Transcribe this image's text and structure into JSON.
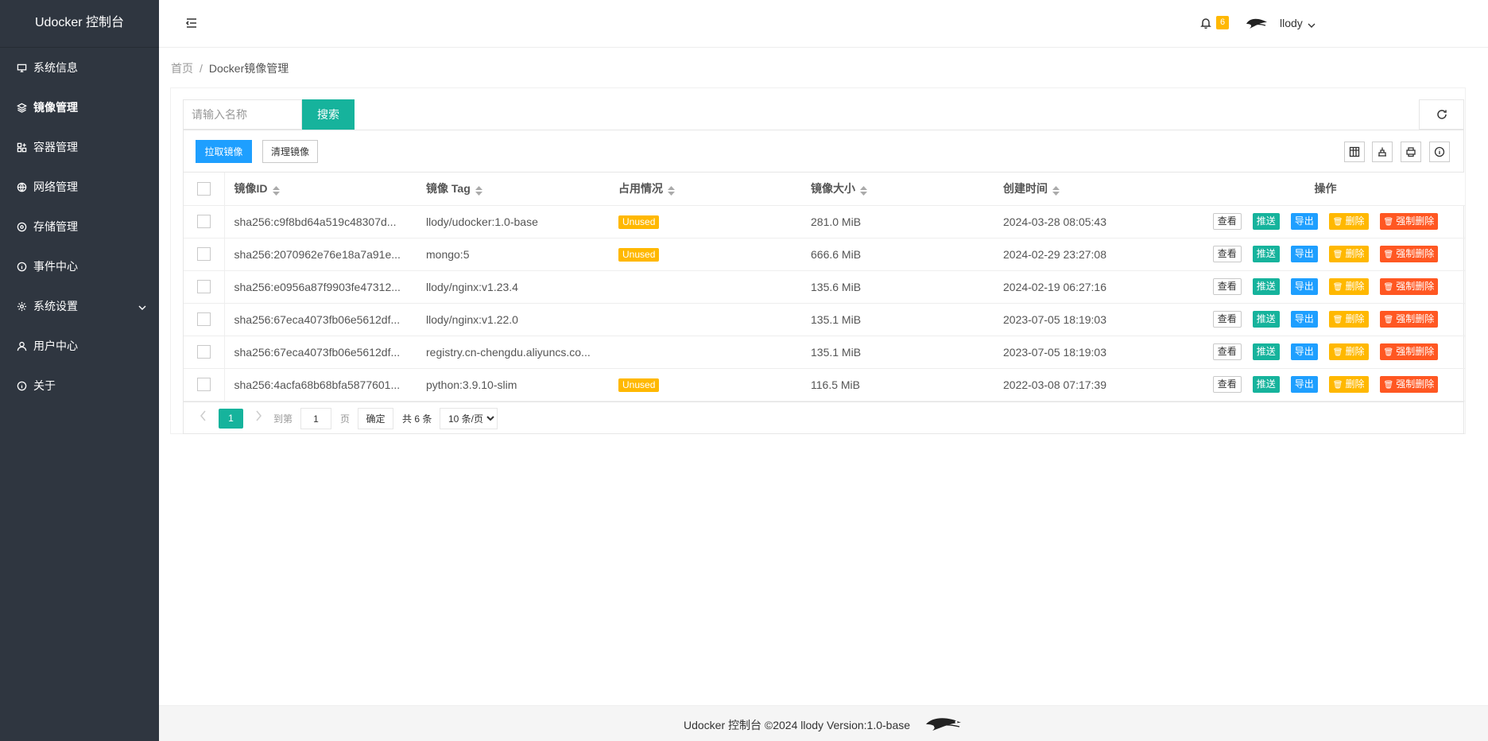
{
  "sidebar": {
    "brand": "Udocker 控制台",
    "items": [
      {
        "label": "系统信息",
        "icon": "monitor-icon"
      },
      {
        "label": "镜像管理",
        "icon": "layers-icon"
      },
      {
        "label": "容器管理",
        "icon": "container-icon"
      },
      {
        "label": "网络管理",
        "icon": "globe-icon"
      },
      {
        "label": "存储管理",
        "icon": "storage-icon"
      },
      {
        "label": "事件中心",
        "icon": "info-icon"
      },
      {
        "label": "系统设置",
        "icon": "gear-icon"
      },
      {
        "label": "用户中心",
        "icon": "user-icon"
      },
      {
        "label": "关于",
        "icon": "info-icon"
      }
    ]
  },
  "header": {
    "notification_count": "6",
    "username": "llody"
  },
  "breadcrumb": {
    "home": "首页",
    "separator": "/",
    "current": "Docker镜像管理"
  },
  "search": {
    "placeholder": "请输入名称",
    "button": "搜索"
  },
  "toolbar": {
    "pull": "拉取镜像",
    "clean": "清理镜像"
  },
  "table": {
    "columns": [
      "镜像ID",
      "镜像 Tag",
      "占用情况",
      "镜像大小",
      "创建时间",
      "操作"
    ],
    "actions": {
      "view": "查看",
      "push": "推送",
      "export": "导出",
      "delete": "删除",
      "force_delete": "强制删除"
    },
    "rows": [
      {
        "id": "sha256:c9f8bd64a519c48307d...",
        "tag": "llody/udocker:1.0-base",
        "usage": "Unused",
        "size": "281.0 MiB",
        "created": "2024-03-28 08:05:43"
      },
      {
        "id": "sha256:2070962e76e18a7a91e...",
        "tag": "mongo:5",
        "usage": "Unused",
        "size": "666.6 MiB",
        "created": "2024-02-29 23:27:08"
      },
      {
        "id": "sha256:e0956a87f9903fe47312...",
        "tag": "llody/nginx:v1.23.4",
        "usage": "",
        "size": "135.6 MiB",
        "created": "2024-02-19 06:27:16"
      },
      {
        "id": "sha256:67eca4073fb06e5612df...",
        "tag": "llody/nginx:v1.22.0",
        "usage": "",
        "size": "135.1 MiB",
        "created": "2023-07-05 18:19:03"
      },
      {
        "id": "sha256:67eca4073fb06e5612df...",
        "tag": "registry.cn-chengdu.aliyuncs.co...",
        "usage": "",
        "size": "135.1 MiB",
        "created": "2023-07-05 18:19:03"
      },
      {
        "id": "sha256:4acfa68b68bfa5877601...",
        "tag": "python:3.9.10-slim",
        "usage": "Unused",
        "size": "116.5 MiB",
        "created": "2022-03-08 07:17:39"
      }
    ]
  },
  "pagination": {
    "current_page": "1",
    "goto_label": "到第",
    "page_label": "页",
    "goto_value": "1",
    "confirm": "确定",
    "total": "共 6 条",
    "page_size": "10 条/页"
  },
  "footer": {
    "text": "Udocker 控制台 ©2024 llody Version:1.0-base"
  },
  "colors": {
    "sidebar_bg": "#2f3640",
    "primary_green": "#16b39c",
    "primary_blue": "#1e9fff",
    "warning": "#ffb800",
    "danger": "#ff5722"
  }
}
